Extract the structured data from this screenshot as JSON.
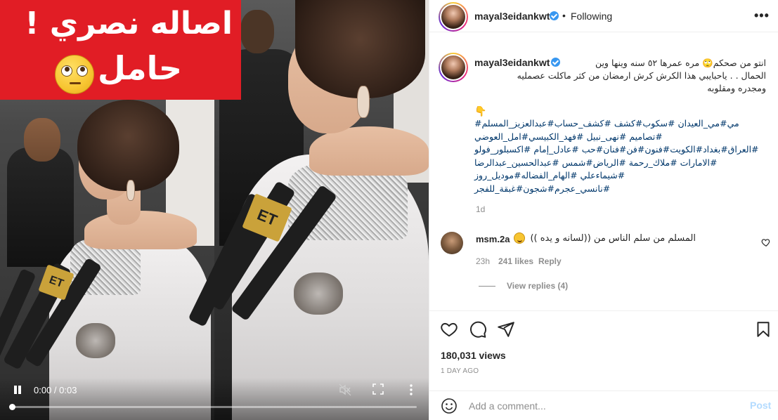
{
  "video": {
    "overlay_title_line1": "اصاله نصري !",
    "overlay_title_line2": "حامل",
    "mic_brand": "ET",
    "time_display": "0:00 / 0:03",
    "progress_fraction": 0.0
  },
  "header": {
    "username": "mayal3eidankwt",
    "separator": "•",
    "follow_state": "Following",
    "more": "•••"
  },
  "caption": {
    "username": "mayal3eidankwt",
    "lines": [
      "انتو من صحكم🙄 مره عمرها ٥٢ سنه وينها وين",
      "الحمال . . ياحبايبي هذا الكرش كرش ارمضان من كثر ماكلت عصمليه",
      "ومجدره ومقلوبه"
    ],
    "pointer": "👇",
    "hashtag_lines": [
      "مي#مي_العيدان #سكوب#كشف #كشف_حساب#عبدالعزيز_المسلم#",
      "#تصاميم #نهى_نبيل #فهد_الكبيسي#امل_العوضي",
      "#العراق#بغداد#الكويت#فنون#فن#فنان#حب #عادل_إمام #اكسبلور_فولو",
      "#الامارات #ملاك_رحمة #الرياض#شمس #عبدالحسين_عبدالرضا",
      "#شيماءعلي #الهام_الفضاله#موديل_روز",
      "#نانسي_عجرم#شجون#غبقة_للفجر"
    ],
    "age": "1d"
  },
  "comment": {
    "username": "msm.2a",
    "text": "المسلم من سلم الناس من ((لسانه و يده ))",
    "time": "23h",
    "likes": "241 likes",
    "reply_label": "Reply",
    "view_replies": "View replies (4)"
  },
  "actions": {
    "views": "180,031 views",
    "date": "1 DAY AGO"
  },
  "composer": {
    "placeholder": "Add a comment...",
    "post_label": "Post"
  },
  "colors": {
    "verified": "#3897f0",
    "link": "#00376b",
    "muted": "#8e8e8e",
    "post_disabled": "#b3dbff",
    "overlay_red": "#e11d25"
  }
}
